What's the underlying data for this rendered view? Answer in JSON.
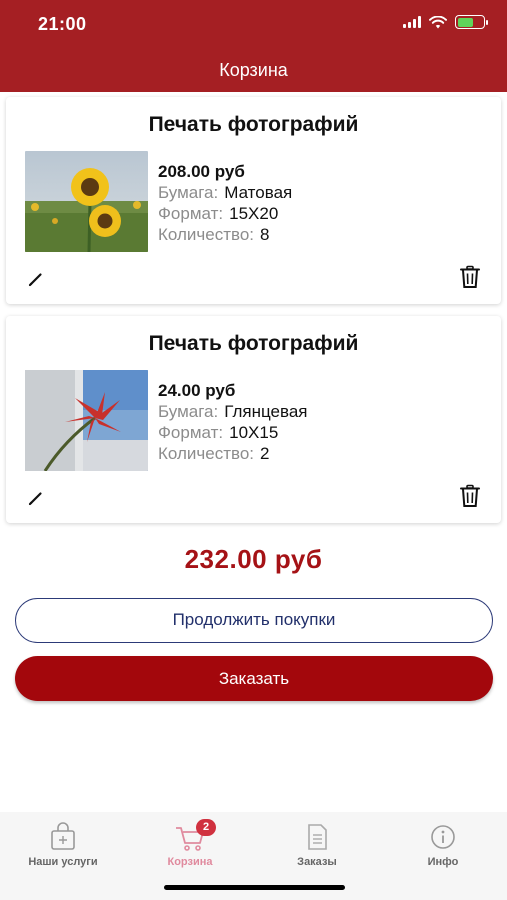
{
  "status_bar": {
    "time": "21:00"
  },
  "header": {
    "title": "Корзина"
  },
  "cart": {
    "items": [
      {
        "title": "Печать фотографий",
        "price": "208.00 руб",
        "paper_label": "Бумага:",
        "paper_value": "Матовая",
        "format_label": "Формат:",
        "format_value": "15X20",
        "quantity_label": "Количество:",
        "quantity_value": "8"
      },
      {
        "title": "Печать фотографий",
        "price": "24.00 руб",
        "paper_label": "Бумага:",
        "paper_value": "Глянцевая",
        "format_label": "Формат:",
        "format_value": "10X15",
        "quantity_label": "Количество:",
        "quantity_value": "2"
      }
    ],
    "total": "232.00  руб"
  },
  "actions": {
    "continue_label": "Продолжить покупки",
    "order_label": "Заказать"
  },
  "tabbar": {
    "services_label": "Наши услуги",
    "cart_label": "Корзина",
    "cart_badge": "2",
    "orders_label": "Заказы",
    "info_label": "Инфо"
  },
  "colors": {
    "brand": "#a51f23",
    "total": "#a51216",
    "order_button": "#a3070c",
    "continue_border": "#2c3a78",
    "tab_active": "#e08a9e"
  }
}
